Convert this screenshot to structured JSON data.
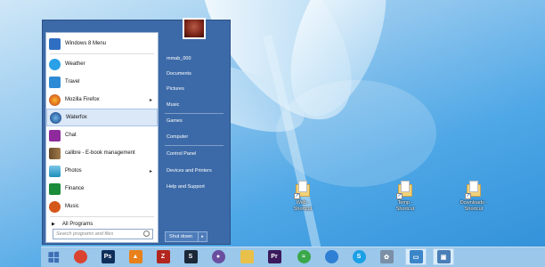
{
  "start_menu": {
    "programs": [
      {
        "label": "Windows 8 Menu",
        "icon": "windows8-menu-icon",
        "color": "#2e6fc4",
        "submenu": false
      },
      {
        "label": "Weather",
        "icon": "weather-icon",
        "color": "#2aa0e6",
        "submenu": false
      },
      {
        "label": "Travel",
        "icon": "travel-icon",
        "color": "#2d8bd6",
        "submenu": false
      },
      {
        "label": "Mozilla Firefox",
        "icon": "firefox-icon",
        "color": "#e26b1c",
        "submenu": true
      },
      {
        "label": "Waterfox",
        "icon": "waterfox-icon",
        "color": "#2b5d9e",
        "submenu": false
      },
      {
        "label": "Chat",
        "icon": "chat-icon",
        "color": "#8e2a9c",
        "submenu": false
      },
      {
        "label": "calibre - E-book management",
        "icon": "calibre-icon",
        "color": "#6b4a2b",
        "submenu": false
      },
      {
        "label": "Photos",
        "icon": "photos-icon",
        "color": "#1d8fb8",
        "submenu": true
      },
      {
        "label": "Finance",
        "icon": "finance-icon",
        "color": "#1a8b3a",
        "submenu": false
      },
      {
        "label": "Music",
        "icon": "music-icon",
        "color": "#d4571c",
        "submenu": false
      }
    ],
    "all_programs": "All Programs",
    "search_placeholder": "Search programs and files",
    "right_items": [
      {
        "label": "mmab_000"
      },
      {
        "label": "Documents"
      },
      {
        "label": "Pictures"
      },
      {
        "label": "Music"
      },
      {
        "label": "Games"
      },
      {
        "label": "Computer"
      },
      {
        "label": "Control Panel"
      },
      {
        "label": "Devices and Printers"
      },
      {
        "label": "Help and Support"
      }
    ],
    "shutdown_label": "Shut down",
    "shutdown_arrow": "▸"
  },
  "desktop": {
    "icons": [
      {
        "label": "Web -\nShortcut"
      },
      {
        "label": "Temp -\nShortcut"
      },
      {
        "label": "Downloads -\nShortcut"
      }
    ]
  },
  "taskbar": {
    "apps": [
      {
        "name": "chrome-icon",
        "glyph": "",
        "color": "#d9432f"
      },
      {
        "name": "photoshop-icon",
        "glyph": "Ps",
        "color": "#0f2f5a"
      },
      {
        "name": "vlc-icon",
        "glyph": "▲",
        "color": "#e8811a"
      },
      {
        "name": "filezilla-icon",
        "glyph": "Z",
        "color": "#b3261e"
      },
      {
        "name": "steam-icon",
        "glyph": "S",
        "color": "#1b2838"
      },
      {
        "name": "pidgin-icon",
        "glyph": "●",
        "color": "#6a4ea0"
      },
      {
        "name": "file-explorer-icon",
        "glyph": "",
        "color": "#e8c04a"
      },
      {
        "name": "premiere-icon",
        "glyph": "Pr",
        "color": "#3a1a5c"
      },
      {
        "name": "spotify-icon",
        "glyph": "≈",
        "color": "#3aa84a"
      },
      {
        "name": "firefox-icon",
        "glyph": "",
        "color": "#2f7fd4"
      },
      {
        "name": "skype-icon",
        "glyph": "S",
        "color": "#1aa0e6"
      },
      {
        "name": "settings-app-icon",
        "glyph": "✿",
        "color": "#7b8fa6"
      },
      {
        "name": "remote-desktop-icon",
        "glyph": "▭",
        "color": "#3a86c8"
      },
      {
        "name": "screenshot-tool-icon",
        "glyph": "▣",
        "color": "#4a7fb8"
      }
    ]
  }
}
